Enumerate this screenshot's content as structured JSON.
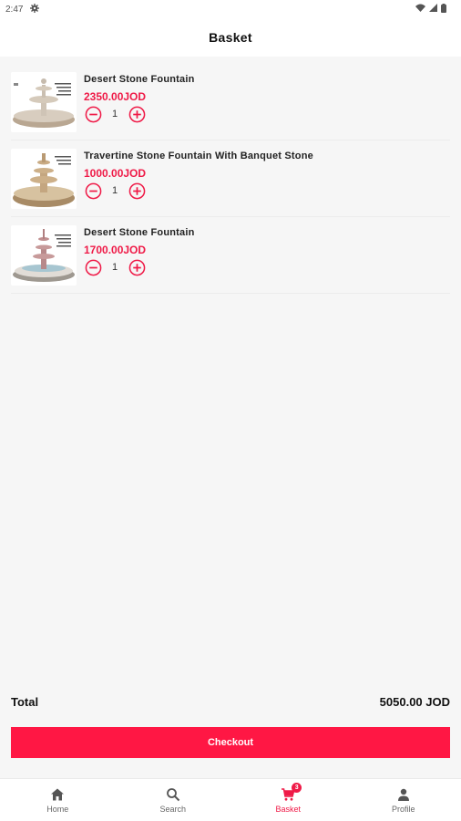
{
  "status_bar": {
    "time": "2:47"
  },
  "header": {
    "title": "Basket"
  },
  "items": [
    {
      "name": "Desert Stone Fountain",
      "price": "2350.00JOD",
      "quantity": "1"
    },
    {
      "name": "Travertine Stone Fountain With Banquet Stone",
      "price": "1000.00JOD",
      "quantity": "1"
    },
    {
      "name": "Desert Stone Fountain",
      "price": "1700.00JOD",
      "quantity": "1"
    }
  ],
  "summary": {
    "total_label": "Total",
    "total_value": "5050.00 JOD"
  },
  "checkout": {
    "label": "Checkout"
  },
  "nav": {
    "items": [
      {
        "label": "Home",
        "icon": "home-icon"
      },
      {
        "label": "Search",
        "icon": "search-icon"
      },
      {
        "label": "Basket",
        "icon": "cart-icon",
        "badge": "3"
      },
      {
        "label": "Profile",
        "icon": "person-icon"
      }
    ]
  },
  "colors": {
    "accent": "#ef1a47",
    "button": "#ff1744",
    "background": "#f6f6f6"
  }
}
